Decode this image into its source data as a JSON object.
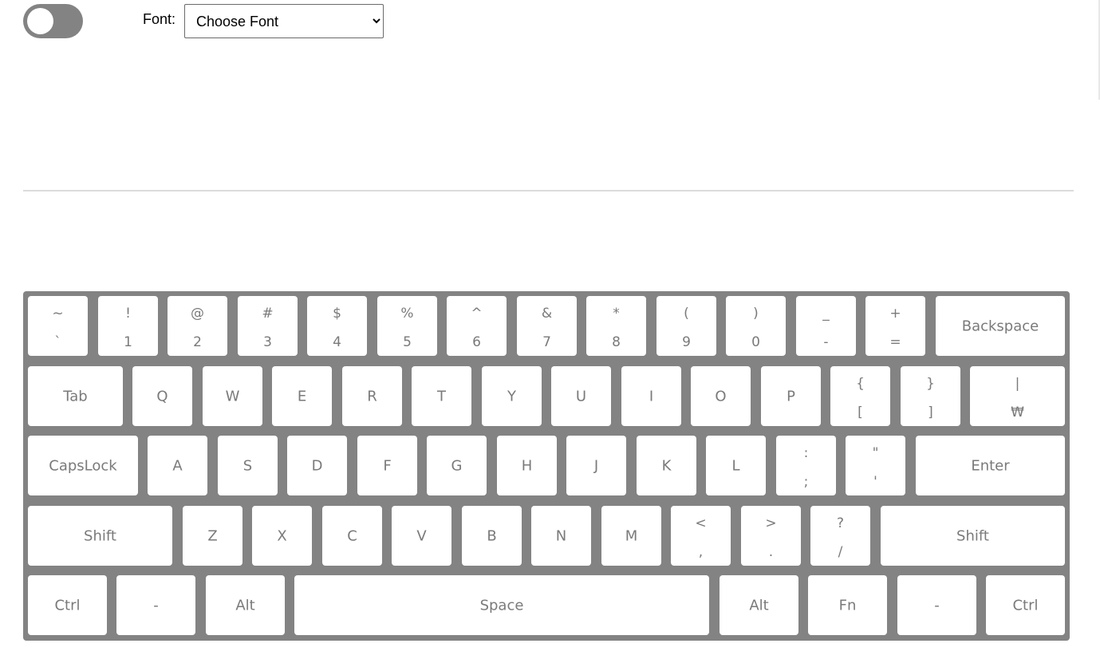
{
  "controls": {
    "font_label": "Font:",
    "font_select_value": "Choose Font",
    "font_options": [
      "Choose Font"
    ]
  },
  "keyboard": {
    "rows": [
      [
        {
          "top": "~",
          "bottom": "`"
        },
        {
          "top": "!",
          "bottom": "1"
        },
        {
          "top": "@",
          "bottom": "2"
        },
        {
          "top": "#",
          "bottom": "3"
        },
        {
          "top": "$",
          "bottom": "4"
        },
        {
          "top": "%",
          "bottom": "5"
        },
        {
          "top": "^",
          "bottom": "6"
        },
        {
          "top": "&",
          "bottom": "7"
        },
        {
          "top": "*",
          "bottom": "8"
        },
        {
          "top": "(",
          "bottom": "9"
        },
        {
          "top": ")",
          "bottom": "0"
        },
        {
          "top": "_",
          "bottom": "-"
        },
        {
          "top": "+",
          "bottom": "="
        },
        {
          "label": "Backspace"
        }
      ],
      [
        {
          "label": "Tab"
        },
        {
          "label": "Q"
        },
        {
          "label": "W"
        },
        {
          "label": "E"
        },
        {
          "label": "R"
        },
        {
          "label": "T"
        },
        {
          "label": "Y"
        },
        {
          "label": "U"
        },
        {
          "label": "I"
        },
        {
          "label": "O"
        },
        {
          "label": "P"
        },
        {
          "top": "{",
          "bottom": "["
        },
        {
          "top": "}",
          "bottom": "]"
        },
        {
          "top": "|",
          "bottom": "₩"
        }
      ],
      [
        {
          "label": "CapsLock"
        },
        {
          "label": "A"
        },
        {
          "label": "S"
        },
        {
          "label": "D"
        },
        {
          "label": "F"
        },
        {
          "label": "G"
        },
        {
          "label": "H"
        },
        {
          "label": "J"
        },
        {
          "label": "K"
        },
        {
          "label": "L"
        },
        {
          "top": ":",
          "bottom": ";"
        },
        {
          "top": "\"",
          "bottom": "'"
        },
        {
          "label": "Enter"
        }
      ],
      [
        {
          "label": "Shift"
        },
        {
          "label": "Z"
        },
        {
          "label": "X"
        },
        {
          "label": "C"
        },
        {
          "label": "V"
        },
        {
          "label": "B"
        },
        {
          "label": "N"
        },
        {
          "label": "M"
        },
        {
          "top": "<",
          "bottom": ","
        },
        {
          "top": ">",
          "bottom": "."
        },
        {
          "top": "?",
          "bottom": "/"
        },
        {
          "label": "Shift"
        }
      ],
      [
        {
          "label": "Ctrl"
        },
        {
          "label": "-"
        },
        {
          "label": "Alt"
        },
        {
          "label": "Space"
        },
        {
          "label": "Alt"
        },
        {
          "label": "Fn"
        },
        {
          "label": "-"
        },
        {
          "label": "Ctrl"
        }
      ]
    ]
  }
}
